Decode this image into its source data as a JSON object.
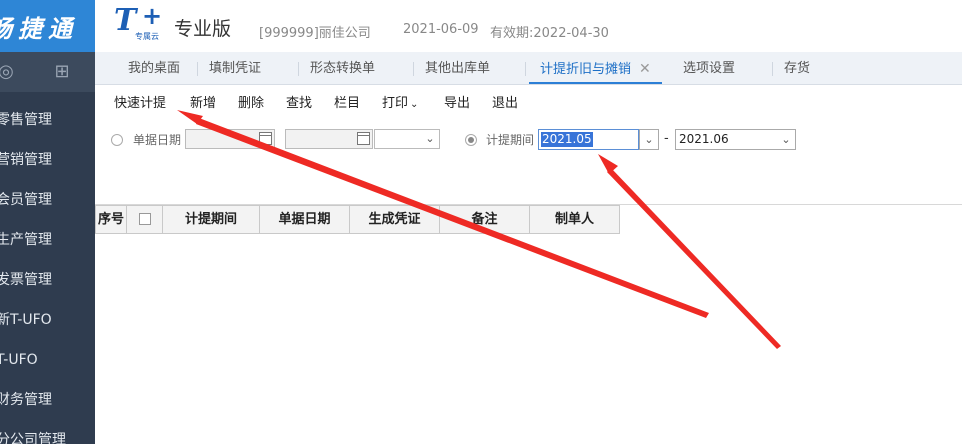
{
  "sidebar": {
    "brand": "畅捷通",
    "items": [
      {
        "label": "零售管理"
      },
      {
        "label": "营销管理"
      },
      {
        "label": "会员管理"
      },
      {
        "label": "生产管理"
      },
      {
        "label": "发票管理"
      },
      {
        "label": "新T-UFO"
      },
      {
        "label": "T-UFO"
      },
      {
        "label": "财务管理"
      },
      {
        "label": "分公司管理"
      }
    ]
  },
  "header": {
    "logo": "T",
    "logo_plus": "+",
    "logo_sub": "专属云",
    "edition": "专业版",
    "company": "[999999]丽佳公司",
    "date": "2021-06-09",
    "validity": "有效期:2022-04-30"
  },
  "tabs": [
    {
      "label": "我的桌面"
    },
    {
      "label": "填制凭证"
    },
    {
      "label": "形态转换单"
    },
    {
      "label": "其他出库单"
    },
    {
      "label": "计提折旧与摊销",
      "close": "✕"
    },
    {
      "label": "选项设置"
    },
    {
      "label": "存货"
    }
  ],
  "toolbar": {
    "quick": "快速计提",
    "add": "新增",
    "delete": "删除",
    "find": "查找",
    "columns": "栏目",
    "print": "打印",
    "export": "导出",
    "exit": "退出"
  },
  "filter": {
    "doc_date_label": "单据日期",
    "period_label": "计提期间",
    "period_from": "2021.05",
    "period_to": "2021.06",
    "dash": "-"
  },
  "grid": {
    "columns": [
      "序号",
      "",
      "计提期间",
      "单据日期",
      "生成凭证",
      "备注",
      "制单人"
    ]
  },
  "colors": {
    "brand": "#2e86d6",
    "sidebar": "#2f3c4f",
    "active_tab": "#1d6fc6",
    "annotation_arrow": "#ee2a24"
  }
}
